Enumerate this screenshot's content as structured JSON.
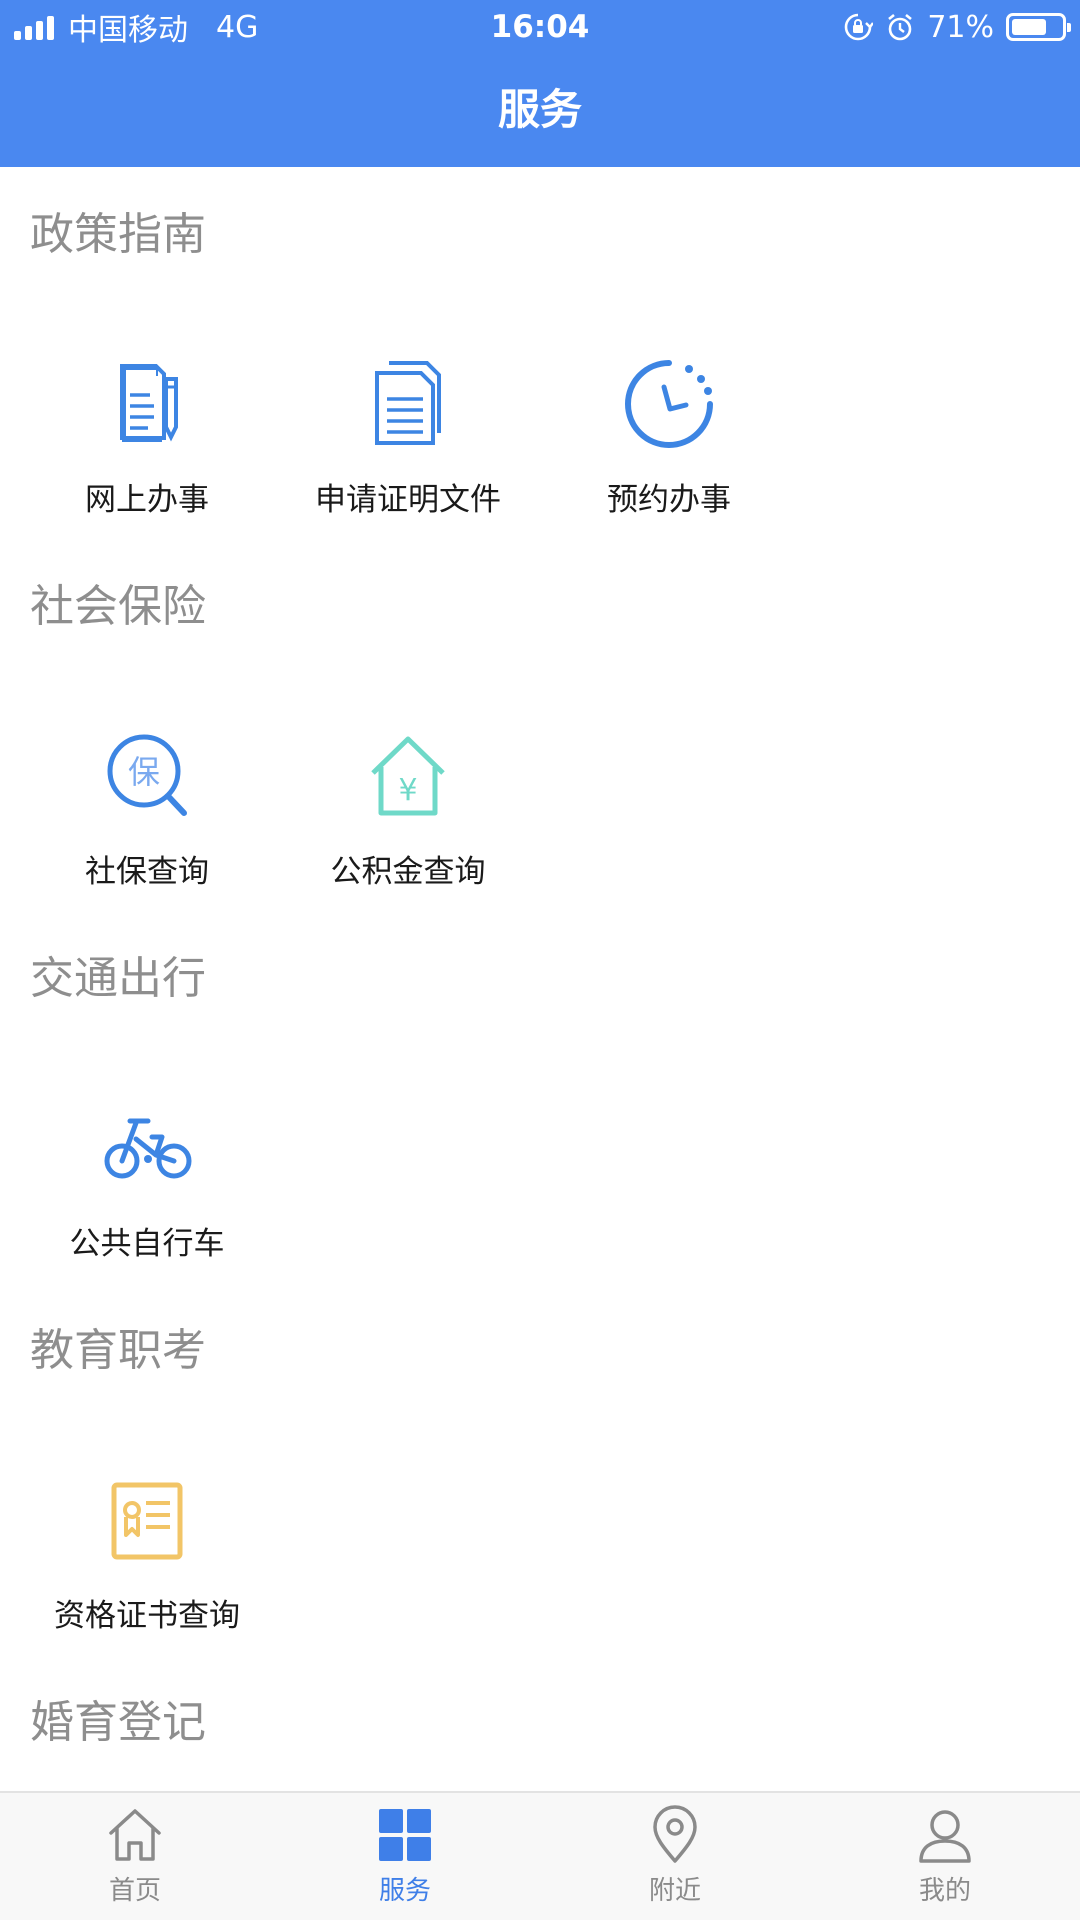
{
  "status_bar": {
    "carrier": "中国移动",
    "network": "4G",
    "time": "16:04",
    "battery": "71%",
    "battery_level": 0.71
  },
  "header": {
    "title": "服务"
  },
  "sections": [
    {
      "title": "政策指南",
      "items": [
        {
          "label": "网上办事",
          "icon": "document-pen-icon"
        },
        {
          "label": "申请证明文件",
          "icon": "documents-icon"
        },
        {
          "label": "预约办事",
          "icon": "clock-icon"
        }
      ]
    },
    {
      "title": "社会保险",
      "items": [
        {
          "label": "社保查询",
          "icon": "insurance-search-icon"
        },
        {
          "label": "公积金查询",
          "icon": "housing-fund-icon"
        }
      ]
    },
    {
      "title": "交通出行",
      "items": [
        {
          "label": "公共自行车",
          "icon": "bicycle-icon"
        }
      ]
    },
    {
      "title": "教育职考",
      "items": [
        {
          "label": "资格证书查询",
          "icon": "certificate-icon"
        }
      ]
    },
    {
      "title": "婚育登记",
      "items": []
    }
  ],
  "icon_text": {
    "insurance": "保",
    "yuan": "¥"
  },
  "tabbar": {
    "tabs": [
      {
        "label": "首页",
        "icon": "home-icon"
      },
      {
        "label": "服务",
        "icon": "grid-icon"
      },
      {
        "label": "附近",
        "icon": "location-pin-icon"
      },
      {
        "label": "我的",
        "icon": "user-icon"
      }
    ],
    "active": "服务"
  },
  "colors": {
    "header_bg": "#4a88f0",
    "icon_blue": "#3d85e3",
    "icon_teal": "#6fd9c8",
    "icon_yellow": "#f2c567",
    "section_title": "#8e8e8e",
    "tab_active": "#3f7fe8",
    "tab_inactive": "#8a8a8a"
  }
}
